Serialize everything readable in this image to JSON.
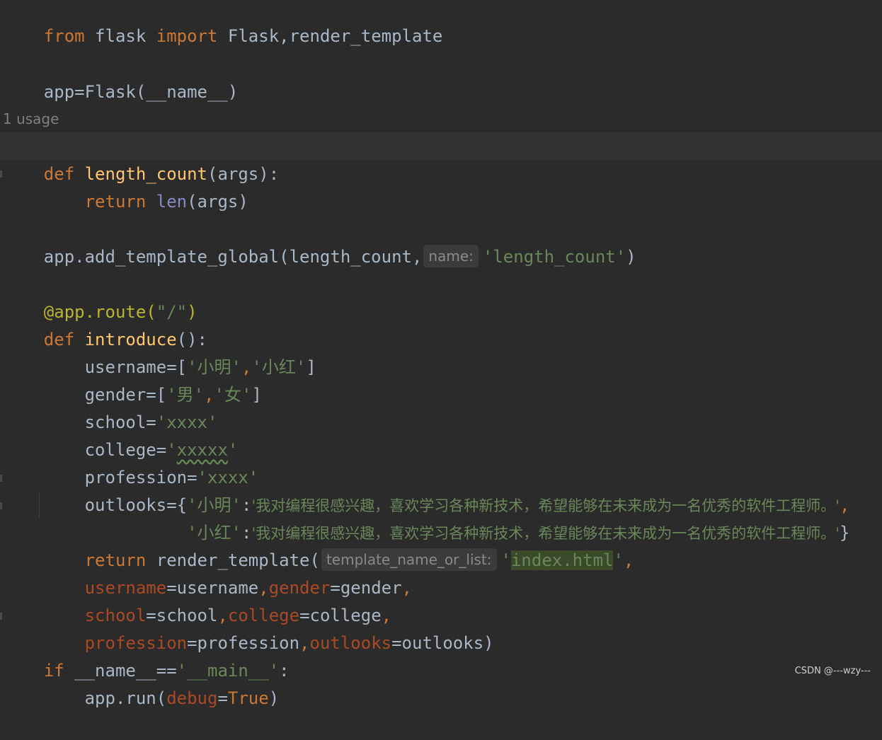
{
  "code": {
    "l1": {
      "kw_from": "from",
      "mod": " flask ",
      "kw_import": "import",
      "names": " Flask,render_template"
    },
    "l2": {
      "text": "app=Flask(__name__)"
    },
    "usage_hint": "1 usage",
    "l3": {
      "kw": "def",
      "sp": " ",
      "fn": "length_count",
      "rest": "(args):"
    },
    "l4": {
      "indent": "    ",
      "kw": "return",
      "sp": " ",
      "builtin": "len",
      "rest": "(args)"
    },
    "l5": {
      "pre": "app.add_template_global(length_count,",
      "hint": "name:",
      "str": "'length_count'",
      "post": ")"
    },
    "l6": {
      "deco": "@app.route(",
      "str": "\"/\"",
      "post": ")"
    },
    "l7": {
      "kw": "def",
      "sp": " ",
      "fn": "introduce",
      "rest": "():"
    },
    "l8": {
      "pre": "    username=[",
      "s1": "'小明'",
      "comma": ",",
      "s2": "'小红'",
      "post": "]"
    },
    "l9": {
      "pre": "    gender=[",
      "s1": "'男'",
      "comma": ",",
      "s2": "'女'",
      "post": "]"
    },
    "l10": {
      "pre": "    school=",
      "str": "'xxxx'"
    },
    "l11": {
      "pre": "    college=",
      "q1": "'",
      "squig": "xxxxx",
      "q2": "'"
    },
    "l12": {
      "pre": "    profession=",
      "str": "'xxxx'"
    },
    "l13": {
      "pre": "    outlooks={",
      "key": "'小明'",
      "colon": ":",
      "val": "'我对编程很感兴趣，喜欢学习各种新技术，希望能够在未来成为一名优秀的软件工程师。'",
      "comma": ","
    },
    "l14": {
      "pre": "              ",
      "key": "'小红'",
      "colon": ":",
      "val": "'我对编程很感兴趣，喜欢学习各种新技术，希望能够在未来成为一名优秀的软件工程师。'",
      "post": "}"
    },
    "l15": {
      "indent": "    ",
      "kw": "return",
      "mid": " render_template(",
      "hint": "template_name_or_list:",
      "q1": "'",
      "str": "index.html",
      "q2": "'",
      "comma": ","
    },
    "l16": {
      "indent": "    ",
      "p1": "username",
      "e1": "=username",
      "c1": ",",
      "p2": "gender",
      "e2": "=gender",
      "c2": ","
    },
    "l17": {
      "indent": "    ",
      "p1": "school",
      "e1": "=school",
      "c1": ",",
      "p2": "college",
      "e2": "=college",
      "c2": ","
    },
    "l18": {
      "indent": "    ",
      "p1": "profession",
      "e1": "=profession",
      "c1": ",",
      "p2": "outlooks",
      "e2": "=outlooks)"
    },
    "l19": {
      "kw": "if",
      "rest": " __name__==",
      "str": "'__main__'",
      "post": ":"
    },
    "l20": {
      "pre": "    app.run(",
      "param": "debug",
      "eq": "=",
      "kw": "True",
      "post": ")"
    }
  },
  "watermark": "CSDN @---wzy---",
  "colors": {
    "background": "#2b2b2b",
    "keyword": "#cc7832",
    "function": "#ffc66d",
    "string": "#6a8759",
    "builtin": "#8888c6",
    "decorator": "#bbb529",
    "param": "#aa4926",
    "text": "#a9b7c6"
  }
}
